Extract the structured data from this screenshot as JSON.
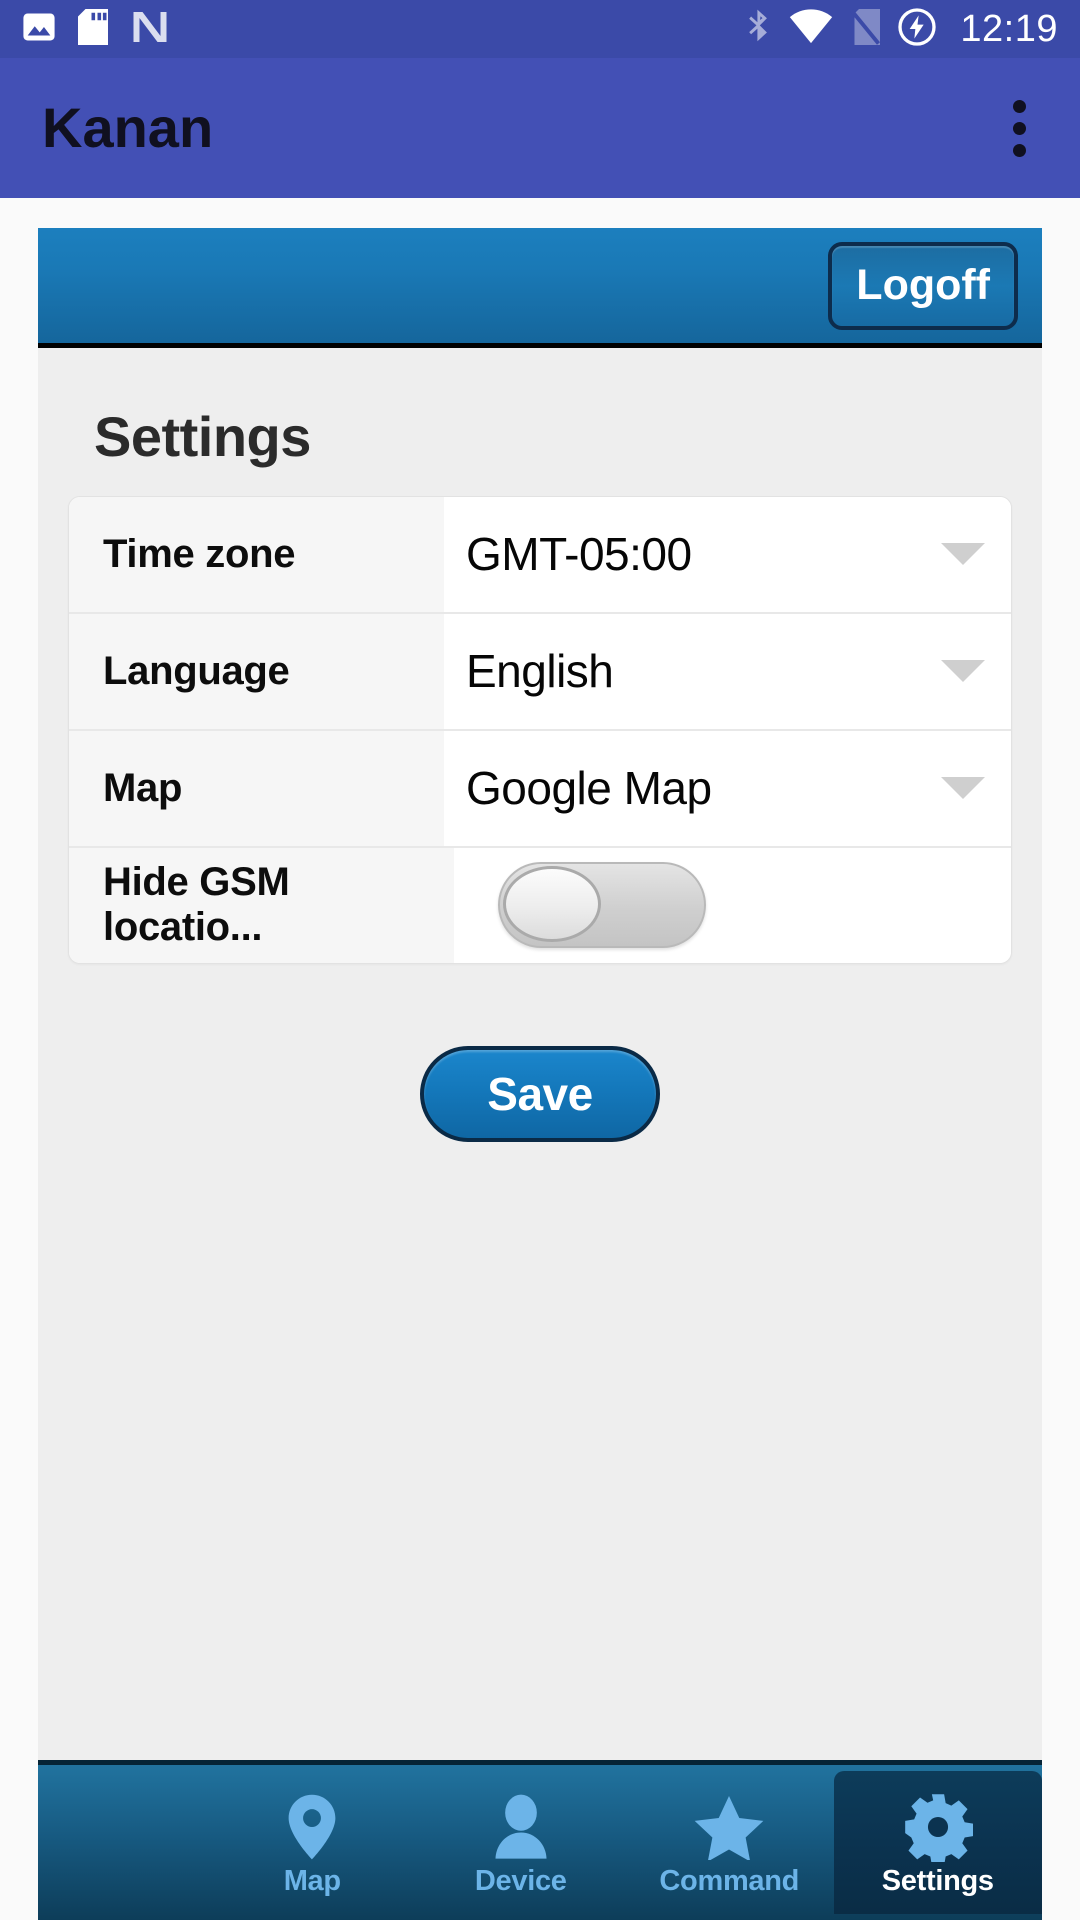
{
  "statusbar": {
    "time": "12:19",
    "icons_left": [
      "photo-icon",
      "sd-card-icon",
      "android-n-icon"
    ],
    "icons_right": [
      "bluetooth-icon",
      "wifi-icon",
      "no-sim-icon",
      "charging-icon"
    ],
    "background_color": "#3b4aa8"
  },
  "appbar": {
    "title": "Kanan",
    "overflow_icon": "more-vertical-icon",
    "background_color": "#4350b5",
    "title_color": "#101020"
  },
  "web_header": {
    "logoff_label": "Logoff",
    "background_color": "#1a79b6"
  },
  "content": {
    "section_title": "Settings",
    "rows": [
      {
        "label": "Time zone",
        "value": "GMT-05:00",
        "control": "dropdown"
      },
      {
        "label": "Language",
        "value": "English",
        "control": "dropdown"
      },
      {
        "label": "Map",
        "value": "Google Map",
        "control": "dropdown"
      },
      {
        "label": "Hide GSM locatio...",
        "value": "",
        "control": "toggle",
        "toggle_state": "off"
      }
    ],
    "save_label": "Save",
    "save_color": "#1478bb"
  },
  "bottom_nav": {
    "active_index": 3,
    "items": [
      {
        "label": "Map",
        "icon": "map-pin-icon"
      },
      {
        "label": "Device",
        "icon": "person-icon"
      },
      {
        "label": "Command",
        "icon": "star-icon"
      },
      {
        "label": "Settings",
        "icon": "gear-icon"
      }
    ],
    "inactive_color": "#6cb4e8",
    "active_color": "#ffffff"
  }
}
